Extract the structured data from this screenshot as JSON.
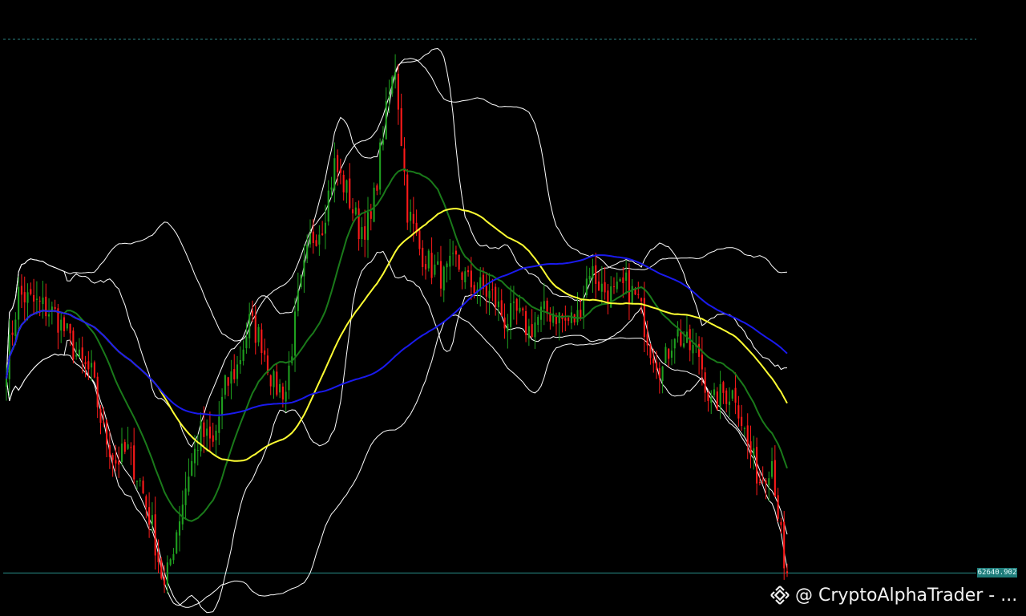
{
  "chart_data": {
    "type": "candlestick",
    "last_price": 62640.902,
    "last_price_label": "62640.902",
    "y_range": [
      61000,
      84500
    ],
    "max_line": 83000,
    "colors": {
      "up": "#1fa01f",
      "down": "#ff1a1a",
      "background": "#000000",
      "bollinger": "#ffffff",
      "ma_fast": "#1a7a1a",
      "ma_mid": "#ffff33",
      "ma_slow": "#1a1aee",
      "price_line": "#2a8f8a",
      "max_line": "#2a7f7f"
    },
    "anchors": [
      70600,
      73300,
      73000,
      72800,
      72500,
      71700,
      70700,
      70200,
      68000,
      66900,
      67300,
      66100,
      64400,
      62000,
      64300,
      66500,
      68000,
      67500,
      69700,
      70500,
      72200,
      71500,
      69800,
      69600,
      73000,
      75300,
      76000,
      78200,
      77200,
      75800,
      76000,
      79500,
      82000,
      76500,
      75000,
      74300,
      73900,
      74500,
      73700,
      73500,
      73200,
      72300,
      72500,
      71900,
      72500,
      72600,
      72200,
      72400,
      74300,
      73500,
      73200,
      73600,
      73000,
      71300,
      70400,
      71900,
      71300,
      71000,
      69000,
      69500,
      69500,
      67500,
      66200,
      67000,
      63000
    ],
    "series": [
      {
        "name": "",
        "kind": "ma",
        "period": 20
      },
      {
        "name": "",
        "kind": "ma",
        "period": 50
      },
      {
        "name": "",
        "kind": "ma",
        "period": 100
      },
      {
        "name": "",
        "kind": "bollinger",
        "period": 20,
        "mult": 2
      },
      {
        "name": "",
        "kind": "bollinger",
        "period": 50,
        "mult": 2
      }
    ]
  },
  "watermark": {
    "icon": "binance-diamond-icon",
    "text": "@ CryptoAlphaTrader - ..."
  }
}
